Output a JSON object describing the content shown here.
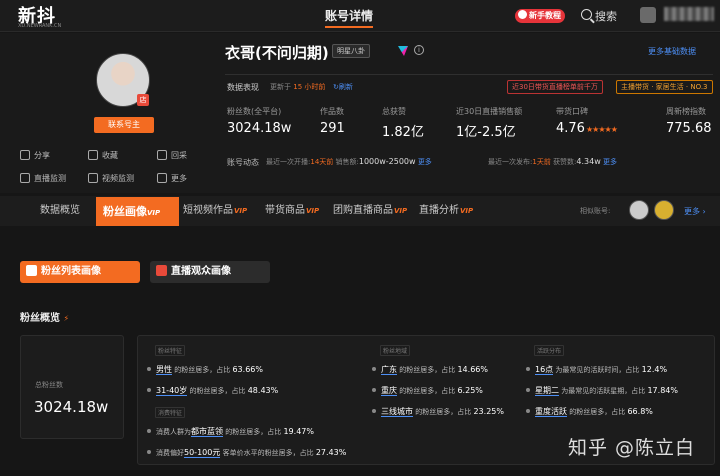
{
  "app": {
    "logo": "新抖",
    "logo_sub": "XD.NEWRANK.CN",
    "page_title": "账号详情",
    "tutorial": "新手教程",
    "search": "搜索"
  },
  "profile": {
    "name": "衣哥(不问归期)",
    "star_tag": "明星八卦",
    "contact": "联系号主",
    "more_basic": "更多基础数据",
    "actions": [
      "分享",
      "收藏",
      "回采",
      "直播监测",
      "视频监测",
      "更多"
    ],
    "data_label": "数据表现",
    "updated_prefix": "更新于",
    "updated_time": "15 小时前",
    "refresh": "刷新",
    "rank_tag": "近30日带货直播榜单前千万",
    "cat_tag": "主播带货 · 家居生活 · NO.3",
    "stats": [
      {
        "label": "粉丝数(全平台)",
        "value": "3024.18w"
      },
      {
        "label": "作品数",
        "value": "291"
      },
      {
        "label": "总获赞",
        "value": "1.82亿"
      },
      {
        "label": "近30日直播销售额",
        "value": "1亿-2.5亿"
      },
      {
        "label": "带货口碑",
        "value": "4.76"
      },
      {
        "label": "周新榜指数",
        "value": "775.68"
      }
    ],
    "rating": 4.76,
    "dyn_label": "账号动态",
    "dyn1": {
      "prefix": "最近一次开播:",
      "time": "14天前",
      "sales_label": "销售额:",
      "sales": "1000w-2500w",
      "more": "更多"
    },
    "dyn2": {
      "prefix": "最近一次发布:",
      "time": "1天前",
      "likes_label": "获赞数:",
      "likes": "4.34w",
      "more": "更多"
    }
  },
  "tabs": {
    "active": "粉丝画像",
    "vip": "VIP",
    "items": [
      "数据概览",
      "短视频作品",
      "带货商品",
      "团购直播商品",
      "直播分析"
    ],
    "similar": "相似账号:",
    "more": "更多"
  },
  "sub_tabs": [
    "粉丝列表画像",
    "直播观众画像"
  ],
  "fans": {
    "title": "粉丝概览",
    "total_label": "总粉丝数",
    "total": "3024.18w",
    "sec_attr": "粉丝特征",
    "sec_consume": "消费特征",
    "sec_region": "粉丝地域",
    "sec_active": "活跃分布",
    "attr": [
      {
        "key": "男性",
        "mid": "的粉丝居多，占比",
        "val": "63.66%"
      },
      {
        "key": "31-40岁",
        "mid": "的粉丝居多，占比",
        "val": "48.43%"
      }
    ],
    "consume": [
      {
        "pre": "消费人群为",
        "key": "都市蓝领",
        "mid": "的粉丝居多，占比",
        "val": "19.47%"
      },
      {
        "pre": "消费偏好",
        "key": "50-100元",
        "mid": "客单价水平的粉丝居多，占比",
        "val": "27.43%"
      }
    ],
    "region": [
      {
        "key": "广东",
        "mid": "的粉丝居多，占比",
        "val": "14.66%"
      },
      {
        "key": "重庆",
        "mid": "的粉丝居多，占比",
        "val": "6.25%"
      },
      {
        "key": "三线城市",
        "mid": "的粉丝居多，占比",
        "val": "23.25%"
      }
    ],
    "active": [
      {
        "key": "16点",
        "mid": "为最常见的活跃时间，占比",
        "val": "12.4%"
      },
      {
        "key": "星期二",
        "mid": "为最常见的活跃星期，占比",
        "val": "17.84%"
      },
      {
        "key": "重度活跃",
        "mid": "的粉丝居多，占比",
        "val": "66.8%"
      }
    ]
  },
  "watermark": "知乎 @陈立白",
  "colors": {
    "accent": "#f36b21",
    "link": "#4d8ff5",
    "bg": "#161616"
  }
}
